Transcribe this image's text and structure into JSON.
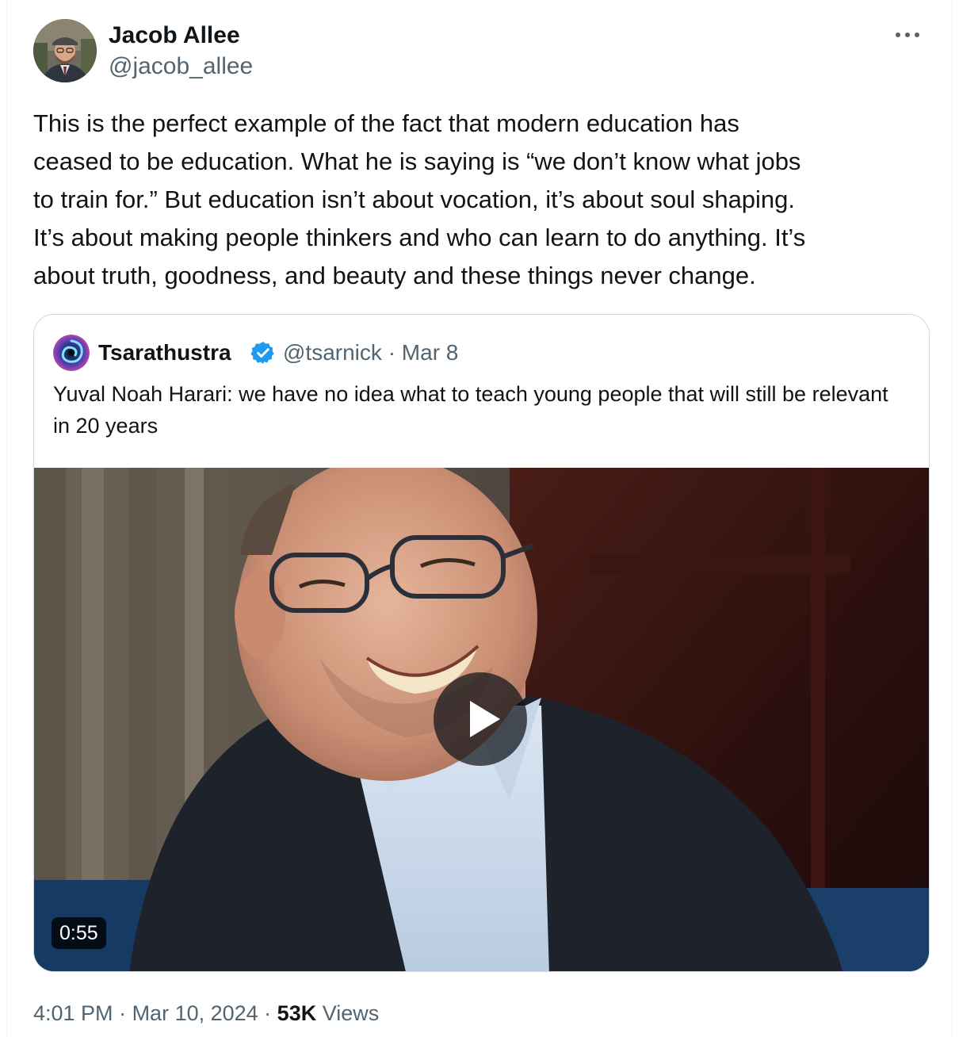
{
  "author": {
    "name": "Jacob Allee",
    "handle": "@jacob_allee"
  },
  "tweet": {
    "text": "This is the perfect example of the fact that modern education has\nceased to be education. What he is saying is “we don’t know what jobs\nto train for.” But education isn’t about vocation, it’s about soul shaping.\nIt’s about making people thinkers and who can learn to do anything. It’s\nabout truth, goodness, and beauty and these things never change."
  },
  "more_icon": "more-horizontal-icon",
  "quote": {
    "name": "Tsarathustra",
    "verified_icon": "verified-badge-icon",
    "handle": "@tsarnick",
    "separator": "·",
    "date": "Mar 8",
    "text": "Yuval Noah Harari: we have no idea what to teach young people that will still be relevant in 20 years",
    "media": {
      "duration": "0:55",
      "play_icon": "play-icon"
    }
  },
  "footer": {
    "time": "4:01 PM",
    "sep1": " · ",
    "date": "Mar 10, 2024",
    "sep2": " · ",
    "views_count": "53K",
    "views_label": " Views"
  },
  "colors": {
    "text_primary": "#0f1419",
    "text_secondary": "#536471",
    "border": "#cfd9de",
    "verified_blue": "#1d9bf0"
  }
}
